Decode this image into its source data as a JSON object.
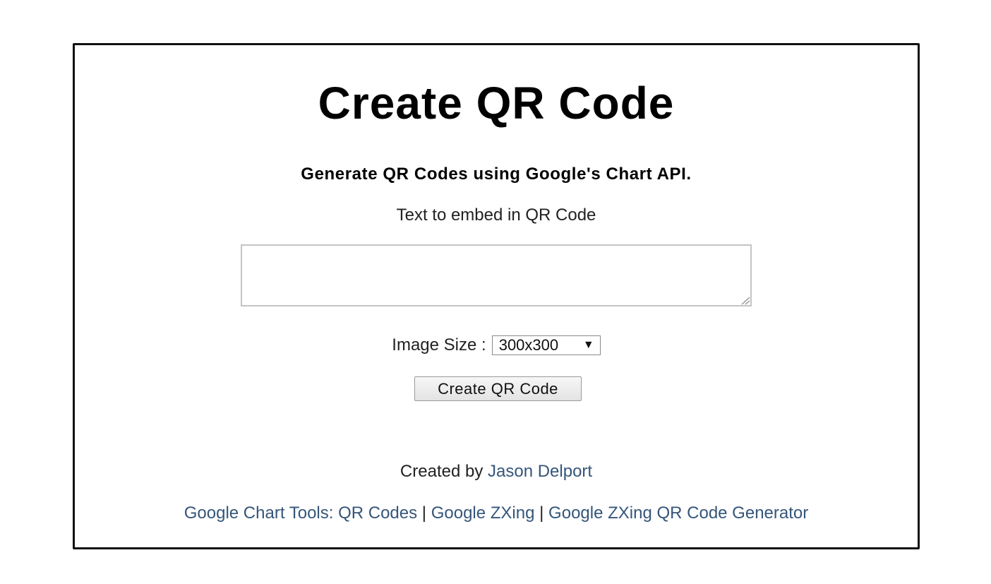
{
  "page": {
    "title": "Create QR Code",
    "subtitle": "Generate QR Codes using Google's Chart API."
  },
  "form": {
    "text_label": "Text to embed in QR Code",
    "text_value": "",
    "size_label": "Image Size :",
    "size_selected": "300x300",
    "size_arrow_icon": "dropdown-triangle-icon",
    "submit_label": "Create QR Code"
  },
  "credit": {
    "prefix": "Created by",
    "author": "Jason Delport"
  },
  "footer": {
    "links": [
      "Google Chart Tools: QR Codes",
      "Google ZXing",
      "Google ZXing QR Code Generator"
    ],
    "separator": "|"
  },
  "colors": {
    "link": "#35567a",
    "text": "#222222",
    "frame_border": "#111111"
  }
}
